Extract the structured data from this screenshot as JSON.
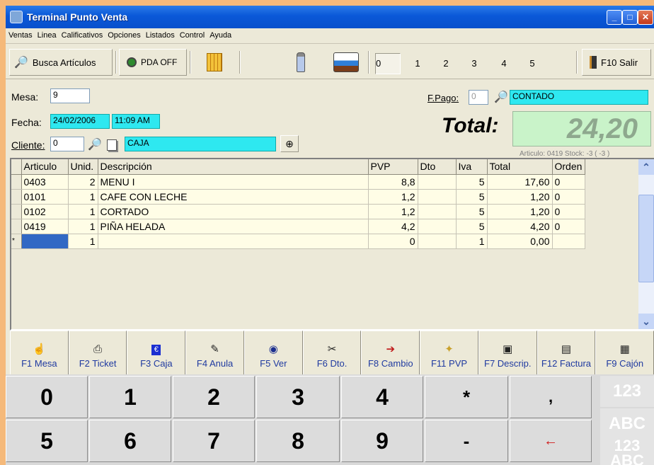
{
  "window": {
    "title": "Terminal Punto Venta"
  },
  "menu": [
    "Ventas",
    "Linea",
    "Calificativos",
    "Opciones",
    "Listados",
    "Control",
    "Ayuda"
  ],
  "toolbar": {
    "busca_label": "Busca Artículos",
    "pda_label": "PDA OFF",
    "tabs": [
      "0",
      "1",
      "2",
      "3",
      "4",
      "5"
    ],
    "salir_label": "F10 Salir"
  },
  "form": {
    "mesa_label": "Mesa:",
    "mesa_value": "9",
    "fecha_label": "Fecha:",
    "fecha_value": "24/02/2006",
    "hora_value": "11:09 AM",
    "cliente_label": "Cliente:",
    "cliente_code": "0",
    "cliente_name": "CAJA",
    "fpago_label": "F.Pago:",
    "fpago_code": "0",
    "fpago_name": "CONTADO",
    "total_label": "Total:",
    "total_value": "24,20",
    "stock_info": "Articulo: 0419   Stock: -3  ( -3 )"
  },
  "grid": {
    "headers": [
      "Articulo",
      "Unid.",
      "Descripción",
      "PVP",
      "Dto",
      "Iva",
      "Total",
      "Orden"
    ],
    "rows": [
      {
        "articulo": "0403",
        "unid": "2",
        "desc": "MENU I",
        "pvp": "8,8",
        "dto": "",
        "iva": "5",
        "total": "17,60",
        "orden": "0"
      },
      {
        "articulo": "0101",
        "unid": "1",
        "desc": "CAFE CON LECHE",
        "pvp": "1,2",
        "dto": "",
        "iva": "5",
        "total": "1,20",
        "orden": "0"
      },
      {
        "articulo": "0102",
        "unid": "1",
        "desc": "CORTADO",
        "pvp": "1,2",
        "dto": "",
        "iva": "5",
        "total": "1,20",
        "orden": "0"
      },
      {
        "articulo": "0419",
        "unid": "1",
        "desc": "PIÑA HELADA",
        "pvp": "4,2",
        "dto": "",
        "iva": "5",
        "total": "4,20",
        "orden": "0"
      },
      {
        "articulo": "",
        "unid": "1",
        "desc": "",
        "pvp": "0",
        "dto": "",
        "iva": "1",
        "total": "0,00",
        "orden": ""
      }
    ],
    "new_row_marker": "*"
  },
  "fkeys": [
    {
      "label": "F1 Mesa",
      "icon": "hand-icon"
    },
    {
      "label": "F2 Ticket",
      "icon": "printer-icon"
    },
    {
      "label": "F3 Caja",
      "icon": "euro-icon"
    },
    {
      "label": "F4 Anula",
      "icon": "erase-icon"
    },
    {
      "label": "F5 Ver",
      "icon": "eye-icon"
    },
    {
      "label": "F6 Dto.",
      "icon": "discount-icon"
    },
    {
      "label": "F8 Cambio",
      "icon": "change-icon"
    },
    {
      "label": "F11 PVP",
      "icon": "price-icon"
    },
    {
      "label": "F7 Descrip.",
      "icon": "note-icon"
    },
    {
      "label": "F12 Factura",
      "icon": "invoice-icon"
    },
    {
      "label": "F9 Cajón",
      "icon": "drawer-icon"
    }
  ],
  "keypad": {
    "row1": [
      "0",
      "1",
      "2",
      "3",
      "4",
      "*",
      ","
    ],
    "row2": [
      "5",
      "6",
      "7",
      "8",
      "9",
      "-",
      "←"
    ],
    "side": [
      "123",
      "ABC",
      "123",
      "ABC"
    ]
  }
}
